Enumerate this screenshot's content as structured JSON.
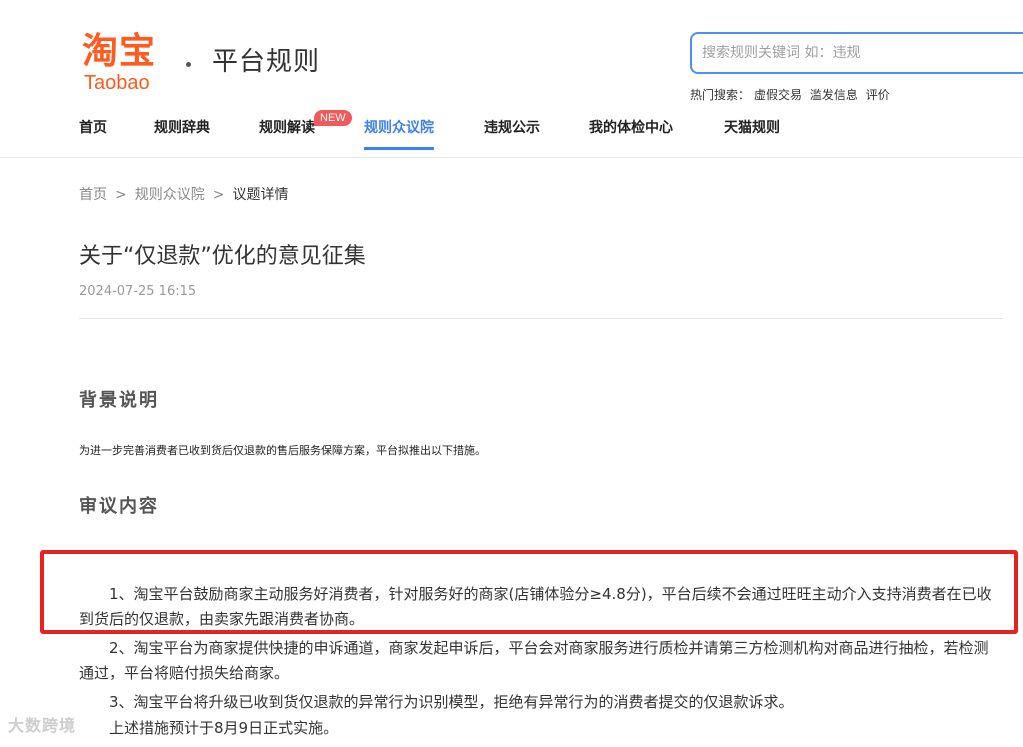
{
  "header": {
    "logo_cn": "淘宝",
    "logo_en": "Taobao",
    "site_title": "平台规则",
    "search_placeholder": "搜索规则关键词 如：违规",
    "hot_search_label": "热门搜索：",
    "hot_search_items": [
      "虚假交易",
      "滥发信息",
      "评价"
    ]
  },
  "nav": {
    "items": [
      {
        "label": "首页"
      },
      {
        "label": "规则辞典"
      },
      {
        "label": "规则解读"
      },
      {
        "label": "规则众议院"
      },
      {
        "label": "违规公示"
      },
      {
        "label": "我的体检中心"
      },
      {
        "label": "天猫规则"
      }
    ],
    "new_badge": "NEW",
    "active_index": 3,
    "active_color": "#3b7ff5"
  },
  "breadcrumb": {
    "items": [
      "首页",
      "规则众议院",
      "议题详情"
    ],
    "separator": ">"
  },
  "article": {
    "title": "关于“仅退款”优化的意见征集",
    "date": "2024-07-25 16:15",
    "background_heading": "背景说明",
    "background_text": "为进一步完善消费者已收到货后仅退款的售后服务保障方案，平台拟推出以下措施。",
    "review_heading": "审议内容",
    "paragraphs": [
      "1、淘宝平台鼓励商家主动服务好消费者，针对服务好的商家(店铺体验分≥4.8分)，平台后续不会通过旺旺主动介入支持消费者在已收到货后的仅退款，由卖家先跟消费者协商。",
      "2、淘宝平台为商家提供快捷的申诉通道，商家发起申诉后，平台会对商家服务进行质检并请第三方检测机构对商品进行抽检，若检测通过，平台将赔付损失给商家。",
      "3、淘宝平台将升级已收到货仅退款的异常行为识别模型，拒绝有异常行为的消费者提交的仅退款诉求。",
      "上述措施预计于8月9日正式实施。"
    ]
  },
  "watermark": "大数跨境",
  "colors": {
    "brand": "#ff5a1f",
    "highlight": "#e8231f",
    "search_border": "#4f8ef7"
  }
}
